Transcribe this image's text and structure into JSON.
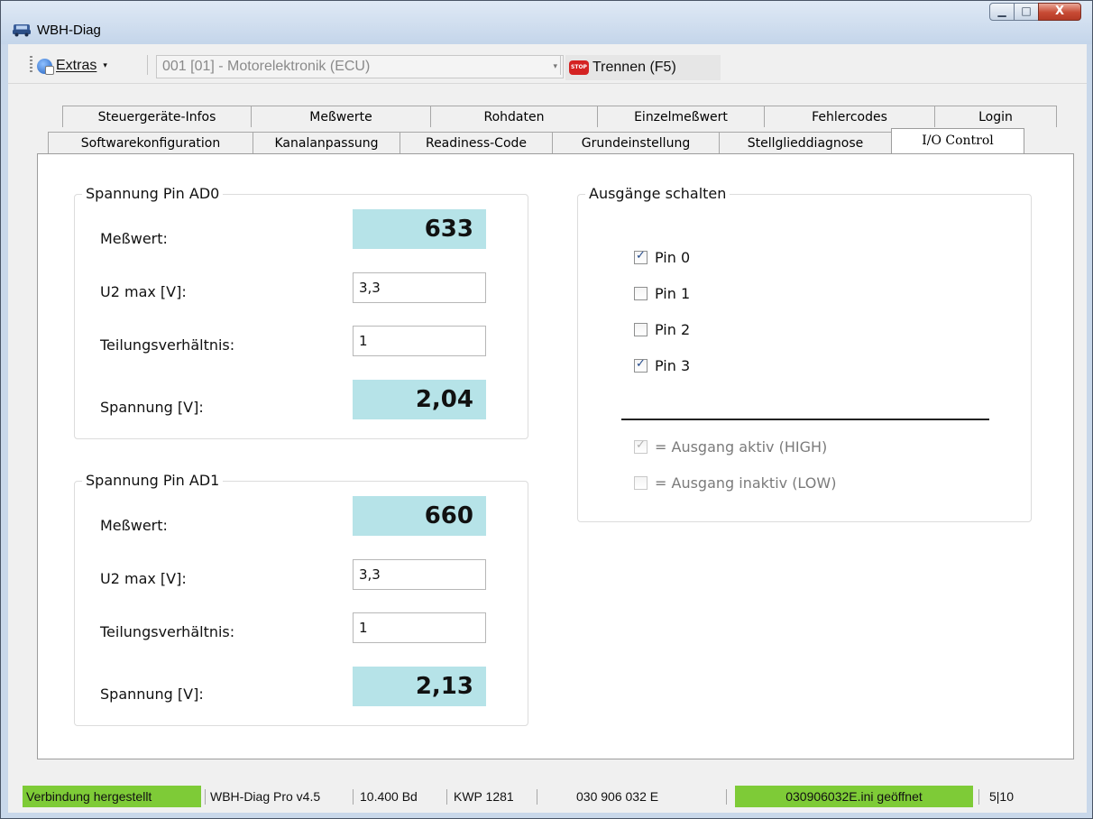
{
  "window": {
    "title": "WBH-Diag",
    "minimize_glyph": "▁",
    "maximize_glyph": "□",
    "close_glyph": "X"
  },
  "toolbar": {
    "extras_label": "Extras",
    "extras_caret": "▾",
    "ecu_select_value": "001 [01] - Motorelektronik (ECU)",
    "ecu_select_arrow": "▾",
    "stop_icon_text": "STOP",
    "disconnect_label": "Trennen (F5)"
  },
  "tabs": {
    "row1": [
      "Steuergeräte-Infos",
      "Meßwerte",
      "Rohdaten",
      "Einzelmeßwert",
      "Fehlercodes",
      "Login"
    ],
    "row2": [
      "Softwarekonfiguration",
      "Kanalanpassung",
      "Readiness-Code",
      "Grundeinstellung",
      "Stellglieddiagnose",
      "I/O Control"
    ],
    "active": "I/O Control"
  },
  "ad0": {
    "title": "Spannung Pin AD0",
    "messwert_label": "Meßwert:",
    "messwert_value": "633",
    "u2max_label": "U2 max [V]:",
    "u2max_value": "3,3",
    "teilung_label": "Teilungsverhältnis:",
    "teilung_value": "1",
    "spannung_label": "Spannung [V]:",
    "spannung_value": "2,04"
  },
  "ad1": {
    "title": "Spannung Pin AD1",
    "messwert_label": "Meßwert:",
    "messwert_value": "660",
    "u2max_label": "U2 max [V]:",
    "u2max_value": "3,3",
    "teilung_label": "Teilungsverhältnis:",
    "teilung_value": "1",
    "spannung_label": "Spannung [V]:",
    "spannung_value": "2,13"
  },
  "outputs": {
    "title": "Ausgänge schalten",
    "pins": [
      {
        "label": "Pin 0",
        "checked": true
      },
      {
        "label": "Pin 1",
        "checked": false
      },
      {
        "label": "Pin 2",
        "checked": false
      },
      {
        "label": "Pin 3",
        "checked": true
      }
    ],
    "legend_active": "= Ausgang aktiv (HIGH)",
    "legend_inactive": "= Ausgang inaktiv (LOW)"
  },
  "statusbar": {
    "connection": "Verbindung hergestellt",
    "version": "WBH-Diag Pro v4.5",
    "baud": "10.400 Bd",
    "protocol": "KWP 1281",
    "part_number": "030 906 032 E",
    "ini_file": "030906032E.ini geöffnet",
    "counter": "5|10"
  },
  "colors": {
    "value_box": "#b6e3e8",
    "status_green": "#7ecb37",
    "stop_red": "#d42222"
  }
}
